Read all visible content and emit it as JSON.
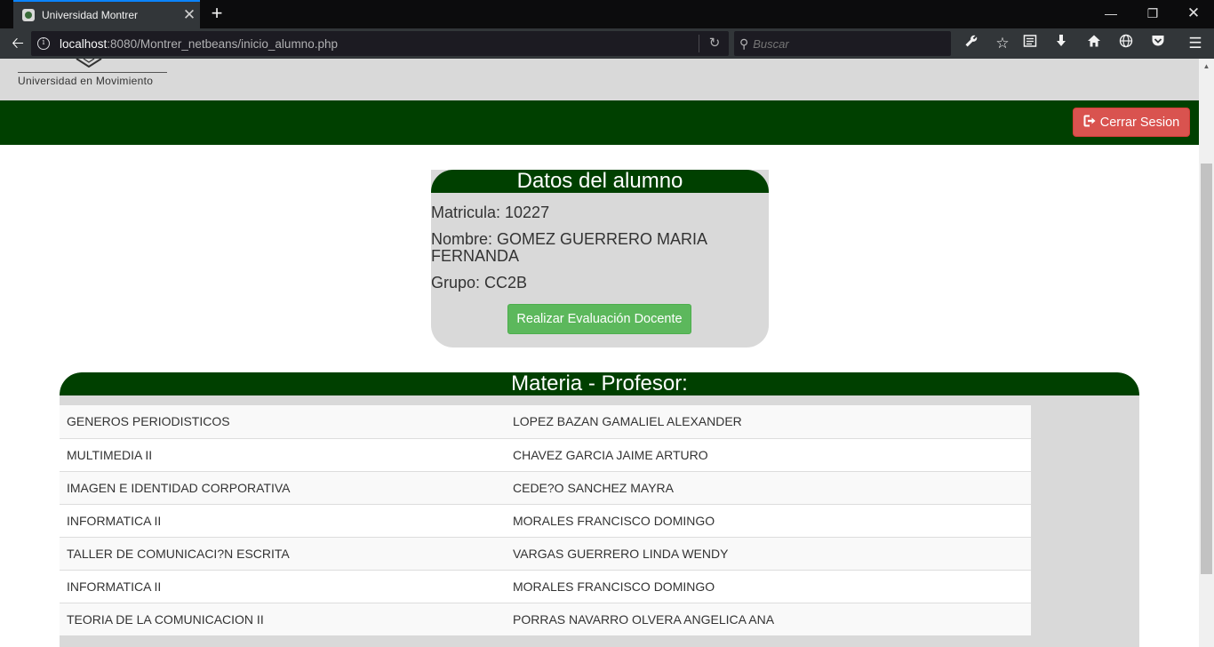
{
  "browser": {
    "tab_title": "Universidad Montrer",
    "url_host": "localhost",
    "url_path": ":8080/Montrer_netbeans/inicio_alumno.php",
    "search_placeholder": "Buscar"
  },
  "header": {
    "logo_text": "Universidad en Movimiento",
    "logout_label": "Cerrar Sesion"
  },
  "student": {
    "title": "Datos del alumno",
    "matricula": "Matricula: 10227",
    "nombre": "Nombre: GOMEZ GUERRERO MARIA FERNANDA",
    "grupo": "Grupo: CC2B",
    "eval_button": "Realizar Evaluación Docente"
  },
  "subjects": {
    "title": "Materia - Profesor:",
    "rows": [
      {
        "materia": "GENEROS PERIODISTICOS",
        "profesor": "LOPEZ BAZAN GAMALIEL ALEXANDER"
      },
      {
        "materia": "MULTIMEDIA II",
        "profesor": "CHAVEZ GARCIA JAIME ARTURO"
      },
      {
        "materia": "IMAGEN E IDENTIDAD CORPORATIVA",
        "profesor": "CEDE?O SANCHEZ MAYRA"
      },
      {
        "materia": "INFORMATICA II",
        "profesor": "MORALES FRANCISCO DOMINGO"
      },
      {
        "materia": "TALLER DE COMUNICACI?N ESCRITA",
        "profesor": "VARGAS GUERRERO LINDA WENDY"
      },
      {
        "materia": "INFORMATICA II",
        "profesor": "MORALES FRANCISCO DOMINGO"
      },
      {
        "materia": "TEORIA DE LA COMUNICACION II",
        "profesor": "PORRAS NAVARRO OLVERA ANGELICA ANA"
      }
    ]
  },
  "colors": {
    "brand_green": "#004000",
    "danger": "#d9534f",
    "success": "#5cb85c",
    "panel_gray": "#d9d9d9"
  },
  "icons": {
    "toolbar": [
      "wrench-icon",
      "star-icon",
      "reader-icon",
      "download-icon",
      "home-icon",
      "globe-icon",
      "pocket-icon",
      "menu-icon"
    ],
    "logout": "sign-out-icon"
  }
}
